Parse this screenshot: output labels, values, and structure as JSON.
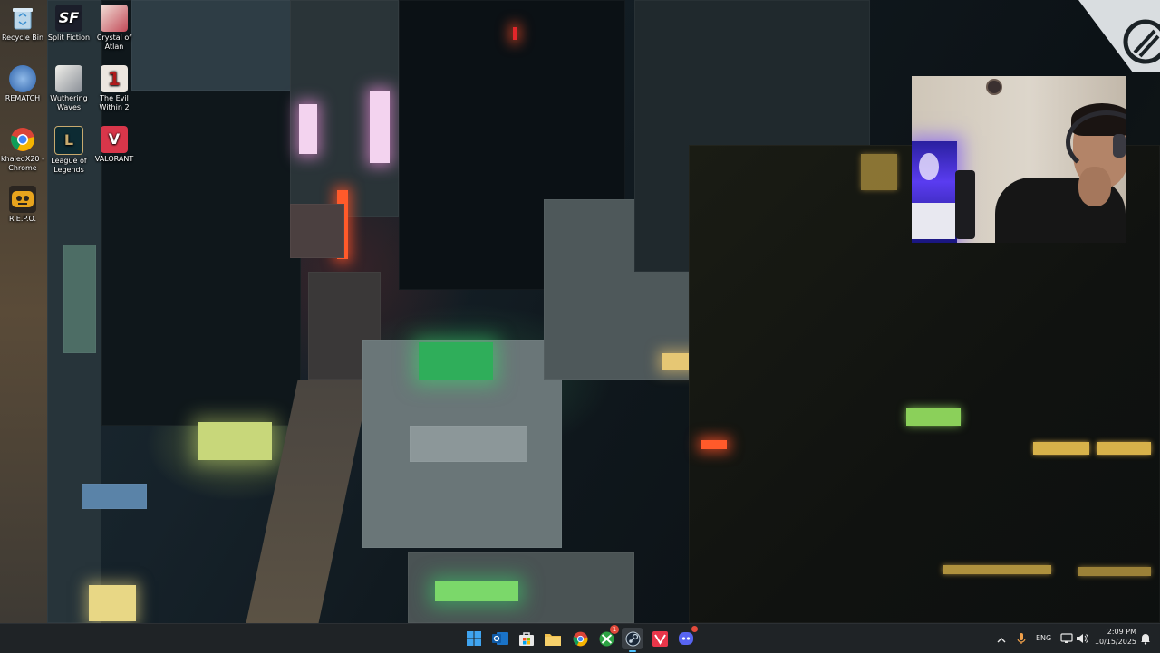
{
  "desktop": {
    "icons": [
      {
        "label": "Recycle Bin",
        "icon": "recycle-bin-icon",
        "color": "#4aa3df"
      },
      {
        "label": "Split Fiction",
        "icon": "split-fiction-icon",
        "glyph": "SF",
        "color": "#1b1e2a"
      },
      {
        "label": "Crystal of Atlan",
        "icon": "crystal-of-atlan-icon",
        "color": "#c24a58"
      },
      {
        "label": "REMATCH",
        "icon": "rematch-icon",
        "color": "#2a5fa8"
      },
      {
        "label": "Wuthering Waves",
        "icon": "wuthering-waves-icon",
        "color": "#d7d5cf"
      },
      {
        "label": "The Evil Within 2",
        "icon": "evil-within-2-icon",
        "glyph": "1",
        "color": "#e9e4dd"
      },
      {
        "label": "khaledX20 - Chrome",
        "icon": "chrome-icon",
        "color": "#34a853"
      },
      {
        "label": "League of Legends",
        "icon": "league-of-legends-icon",
        "glyph": "L",
        "color": "#0d2b33"
      },
      {
        "label": "VALORANT",
        "icon": "valorant-icon",
        "glyph": "V",
        "color": "#d8364a"
      },
      {
        "label": "R.E.P.O.",
        "icon": "repo-icon",
        "color": "#e8a41d"
      }
    ]
  },
  "taskbar": {
    "apps": [
      {
        "name": "start-button",
        "icon": "windows-start-icon",
        "color": "#3fa4f0"
      },
      {
        "name": "outlook-button",
        "icon": "outlook-icon",
        "color": "#1a73c8"
      },
      {
        "name": "store-button",
        "icon": "microsoft-store-icon",
        "color": "#e8e8e8"
      },
      {
        "name": "file-explorer-button",
        "icon": "folder-icon",
        "color": "#f2c14e"
      },
      {
        "name": "chrome-button",
        "icon": "chrome-icon",
        "color": "#34a853"
      },
      {
        "name": "xbox-button",
        "icon": "xbox-icon",
        "color": "#2ca243",
        "badge": "1"
      },
      {
        "name": "steam-button",
        "icon": "steam-icon",
        "color": "#c7d5e0"
      },
      {
        "name": "valorant-button",
        "icon": "valorant-icon",
        "color": "#e8364a"
      },
      {
        "name": "discord-button",
        "icon": "discord-icon",
        "color": "#5865f2"
      }
    ],
    "tray": {
      "language": "ENG",
      "time": "2:09 PM",
      "date": "10/15/2025"
    }
  }
}
